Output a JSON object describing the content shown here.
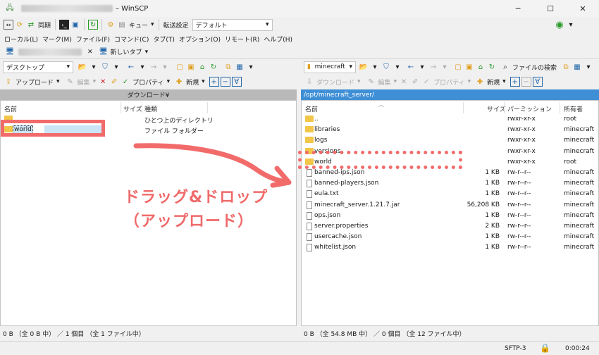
{
  "window": {
    "title": "– WinSCP",
    "ctrl_min": "─",
    "ctrl_max": "☐",
    "ctrl_close": "✕"
  },
  "toolbar": {
    "sync_label": "同期",
    "queue_label": "キュー",
    "transfer_label": "転送設定",
    "transfer_value": "デフォルト"
  },
  "menu": [
    "ローカル(L)",
    "マーク(M)",
    "ファイル(F)",
    "コマンド(C)",
    "タブ(T)",
    "オプション(O)",
    "リモート(R)",
    "ヘルプ(H)"
  ],
  "tabs": {
    "new_tab": "新しいタブ"
  },
  "left": {
    "location": "デスクトップ",
    "upload": "アップロード",
    "edit": "編集",
    "properties": "プロパティ",
    "new": "新規",
    "path": "ダウンロード¥",
    "columns": {
      "name": "名前",
      "size": "サイズ",
      "type": "種類"
    },
    "files": [
      {
        "name": "..",
        "size": "",
        "type": "ひとつ上のディレクトリ"
      },
      {
        "name": "world",
        "size": "",
        "type": "ファイル フォルダー"
      }
    ],
    "status": "0 B （全 0 B 中） ／ 1 個目 （全 1 ファイル中）"
  },
  "right": {
    "location": "minecraft",
    "download": "ダウンロード",
    "edit": "編集",
    "properties": "プロパティ",
    "new": "新規",
    "find": "ファイルの検索",
    "path": "/opt/minecraft_server/",
    "columns": {
      "name": "名前",
      "size": "サイズ",
      "perm": "パーミッション",
      "owner": "所有者"
    },
    "files": [
      {
        "name": "..",
        "size": "",
        "perm": "rwxr-xr-x",
        "owner": "root",
        "kind": "folder"
      },
      {
        "name": "libraries",
        "size": "",
        "perm": "rwxr-xr-x",
        "owner": "minecraft",
        "kind": "folder"
      },
      {
        "name": "logs",
        "size": "",
        "perm": "rwxr-xr-x",
        "owner": "minecraft",
        "kind": "folder"
      },
      {
        "name": "versions",
        "size": "",
        "perm": "rwxr-xr-x",
        "owner": "minecraft",
        "kind": "folder"
      },
      {
        "name": "world",
        "size": "",
        "perm": "rwxr-xr-x",
        "owner": "root",
        "kind": "folder"
      },
      {
        "name": "banned-ips.json",
        "size": "1 KB",
        "perm": "rw-r--r--",
        "owner": "minecraft",
        "kind": "file"
      },
      {
        "name": "banned-players.json",
        "size": "1 KB",
        "perm": "rw-r--r--",
        "owner": "minecraft",
        "kind": "file"
      },
      {
        "name": "eula.txt",
        "size": "1 KB",
        "perm": "rw-r--r--",
        "owner": "minecraft",
        "kind": "file"
      },
      {
        "name": "minecraft_server.1.21.7.jar",
        "size": "56,208 KB",
        "perm": "rw-r--r--",
        "owner": "minecraft",
        "kind": "file"
      },
      {
        "name": "ops.json",
        "size": "1 KB",
        "perm": "rw-r--r--",
        "owner": "minecraft",
        "kind": "file"
      },
      {
        "name": "server.properties",
        "size": "2 KB",
        "perm": "rw-r--r--",
        "owner": "minecraft",
        "kind": "file"
      },
      {
        "name": "usercache.json",
        "size": "1 KB",
        "perm": "rw-r--r--",
        "owner": "minecraft",
        "kind": "file"
      },
      {
        "name": "whitelist.json",
        "size": "1 KB",
        "perm": "rw-r--r--",
        "owner": "minecraft",
        "kind": "file"
      }
    ],
    "status": "0 B （全 54.8 MB 中） ／ 0 個目 （全 12 ファイル中）"
  },
  "footer": {
    "protocol": "SFTP-3",
    "elapsed": "0:00:24"
  },
  "annotation": {
    "line1": "ドラッグ&ドロップ",
    "line2": "（アップロード）",
    "color": "#f06a6a"
  }
}
